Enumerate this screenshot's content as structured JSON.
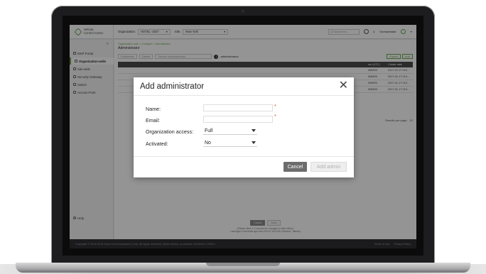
{
  "app": {
    "logo_line1": "Nebula",
    "logo_line2": "Control Center"
  },
  "header": {
    "organization_label": "Organization:",
    "organization_value": "HOTEL -2027",
    "site_label": "Site:",
    "site_value": "New York",
    "search_placeholder": "Q Search for...",
    "user_label": "Ovnbaretator"
  },
  "sidebar": {
    "items": [
      {
        "label": "MSP Portal"
      },
      {
        "label": "Organization-wide"
      },
      {
        "label": "Site-wide"
      },
      {
        "label": "Security Gateway"
      },
      {
        "label": "Switch"
      },
      {
        "label": "Access Point"
      }
    ],
    "help_label": "Help"
  },
  "main": {
    "breadcrumb": "Organization-wide > Configure > Administrator",
    "title": "Administrator",
    "toolbar": {
      "btn1": "Edit/delete",
      "btn2": "Delete",
      "search_placeholder": "Search administrators",
      "count": "1",
      "count_label": "administrators",
      "export": "Export",
      "add": "Add"
    },
    "table_columns": {
      "time": "me (UTC)",
      "create": "Create date"
    },
    "table_rows": [
      {
        "time": "0MMS0",
        "create": "2017-01-17 013..."
      },
      {
        "time": "0MMS0",
        "create": "2017-01-17 013..."
      },
      {
        "time": "0MMS0",
        "create": "2017-01-17 013..."
      },
      {
        "time": "0MMS0",
        "create": "2017-01-17 013..."
      }
    ],
    "results_label": "Results per page:",
    "results_value": "10"
  },
  "bottom_bar": {
    "cancel": "Cancel",
    "save": "Save",
    "note": "(Please allow 1-2 minutes for changes to take effect.)",
    "last_login": "Last login: 5 seconds ago from 203.67.153.200 (Hsinchu, Taiwan)"
  },
  "footer": {
    "copyright": "Copyright © 2016-2018 Zyxel Communications Corp. All rights reserved | Build version: production 20180914 175810",
    "terms": "Terms of use",
    "privacy": "Privacy Policy"
  },
  "modal": {
    "title": "Add administrator",
    "name_label": "Name:",
    "email_label": "Email:",
    "access_label": "Organization access:",
    "access_value": "Full",
    "activated_label": "Activated:",
    "activated_value": "No",
    "required_mark": "*",
    "cancel": "Cancel",
    "add": "Add admin"
  },
  "colors": {
    "accent": "#6aa84f",
    "required": "#e53935",
    "cancel_bg": "#6d6d6d"
  }
}
